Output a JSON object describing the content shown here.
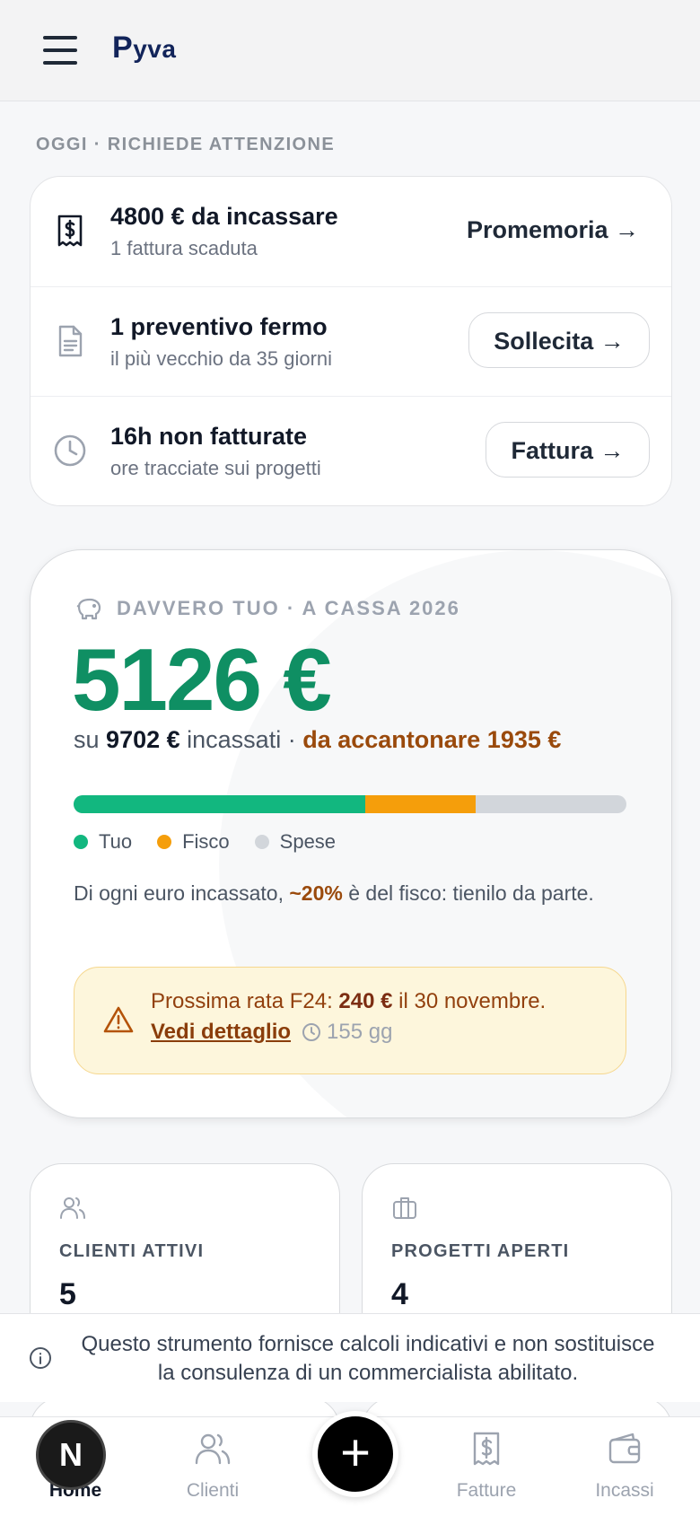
{
  "header": {
    "logo_p": "P",
    "logo_rest": "yva"
  },
  "attention": {
    "section_label": "OGGI · RICHIEDE ATTENZIONE",
    "rows": [
      {
        "icon": "receipt-dollar-icon",
        "title": "4800 € da incassare",
        "subtitle": "1 fattura scaduta",
        "action": "Promemoria →"
      },
      {
        "icon": "document-icon",
        "title": "1 preventivo fermo",
        "subtitle": "il più vecchio da 35 giorni",
        "action": "Sollecita →"
      },
      {
        "icon": "clock-icon",
        "title": "16h non fatturate",
        "subtitle": "ore tracciate sui progetti",
        "action": "Fattura →"
      }
    ]
  },
  "cash": {
    "label": "DAVVERO TUO · A CASSA 2026",
    "amount": "5126 €",
    "sub_prefix": "su",
    "sub_total": "9702 €",
    "sub_mid": "incassati ·",
    "sub_accent": "da accantonare 1935 €",
    "bar": {
      "tuo": 0.5283,
      "fisco": 0.1994,
      "colors": {
        "tuo": "#12b77f",
        "fisco": "#f59e0b",
        "spese": "#d2d6db"
      }
    },
    "legend": [
      "Tuo",
      "Fisco",
      "Spese"
    ],
    "note_prefix": "Di ogni euro incassato,",
    "note_accent": "~20%",
    "note_suffix": "è del fisco: tienilo da parte.",
    "f24": {
      "prefix": "Prossima rata F24:",
      "amount": "240 €",
      "suffix": "il 30 novembre.",
      "link": "Vedi dettaglio",
      "days": "155 gg"
    }
  },
  "stats": [
    {
      "icon": "users-icon",
      "label": "CLIENTI ATTIVI",
      "value": "5"
    },
    {
      "icon": "briefcase-icon",
      "label": "PROGETTI APERTI",
      "value": "4"
    }
  ],
  "disclaimer": "Questo strumento fornisce calcoli indicativi e non sostituisce la consulenza di un commercialista abilitato.",
  "nav": {
    "home": "Home",
    "home_badge": "N",
    "clienti": "Clienti",
    "fab": "+",
    "fatture": "Fatture",
    "incassi": "Incassi"
  }
}
